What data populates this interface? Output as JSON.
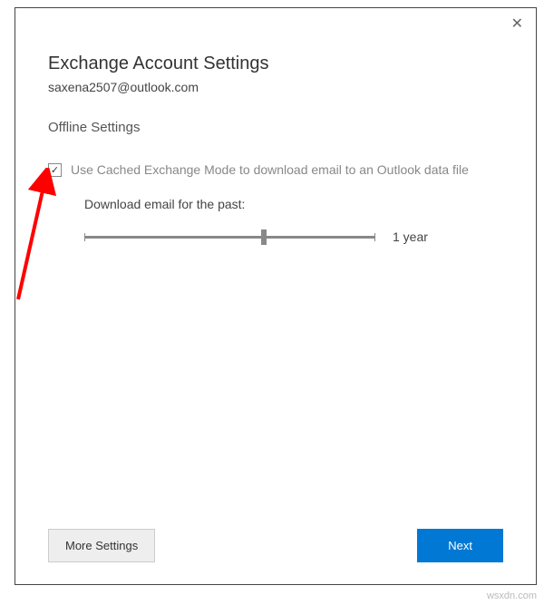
{
  "dialog": {
    "title": "Exchange Account Settings",
    "email": "saxena2507@outlook.com",
    "close_glyph": "✕"
  },
  "offline": {
    "section_label": "Offline Settings",
    "cached_mode_label": "Use Cached Exchange Mode to download email to an Outlook data file",
    "cached_mode_checked": "✓",
    "download_label": "Download email for the past:",
    "slider_value": "1 year"
  },
  "buttons": {
    "more_settings": "More Settings",
    "next": "Next"
  },
  "watermark": "wsxdn.com"
}
